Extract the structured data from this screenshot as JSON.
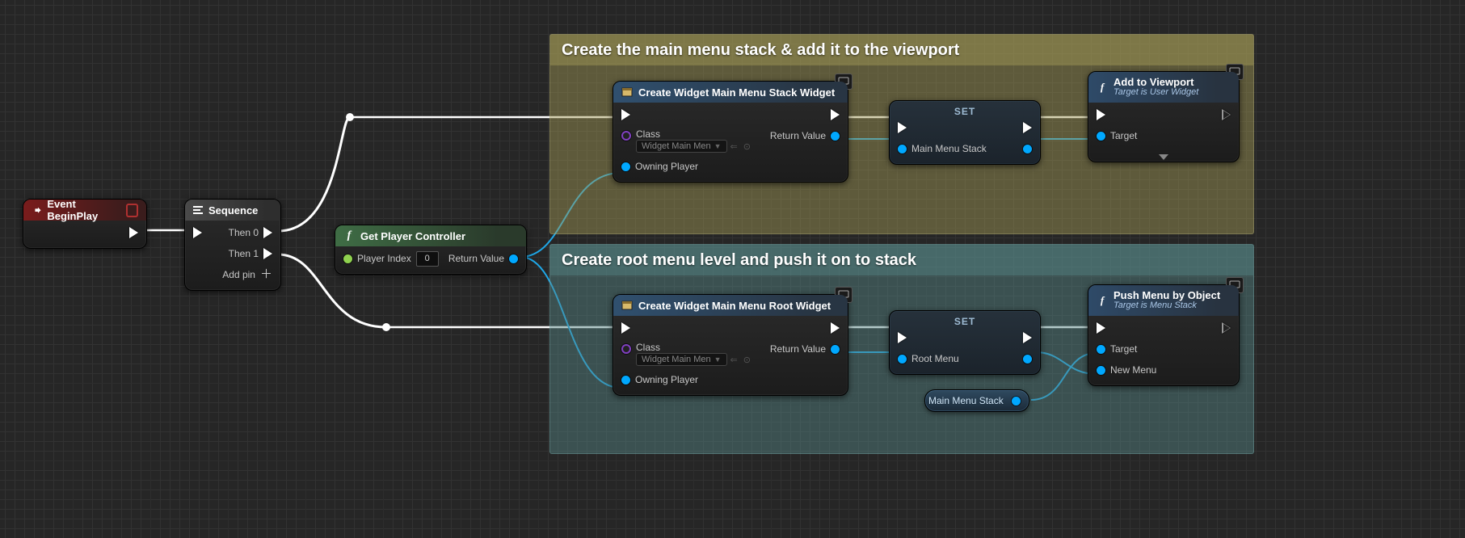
{
  "comments": {
    "top": "Create the main menu stack & add it to the viewport",
    "bottom": "Create root menu level and push it on to stack"
  },
  "eventNode": {
    "title": "Event BeginPlay"
  },
  "sequence": {
    "title": "Sequence",
    "then0": "Then 0",
    "then1": "Then 1",
    "addpin": "Add pin"
  },
  "getPC": {
    "title": "Get Player Controller",
    "playerIndex": "Player Index",
    "playerIndexVal": "0",
    "returnValue": "Return Value"
  },
  "createStack": {
    "title": "Create Widget Main Menu Stack Widget",
    "classLabel": "Class",
    "classValue": "Widget Main Men",
    "owningPlayer": "Owning Player",
    "returnValue": "Return Value"
  },
  "createRoot": {
    "title": "Create Widget Main Menu Root Widget",
    "classLabel": "Class",
    "classValue": "Widget Main Men",
    "owningPlayer": "Owning Player",
    "returnValue": "Return Value"
  },
  "setStack": {
    "title": "SET",
    "var": "Main Menu Stack"
  },
  "setRoot": {
    "title": "SET",
    "var": "Root Menu"
  },
  "addViewport": {
    "title": "Add to Viewport",
    "subtitle": "Target is User Widget",
    "target": "Target"
  },
  "pushMenu": {
    "title": "Push Menu by Object",
    "subtitle": "Target is Menu Stack",
    "target": "Target",
    "newMenu": "New Menu"
  },
  "varGet": {
    "label": "Main Menu Stack"
  }
}
